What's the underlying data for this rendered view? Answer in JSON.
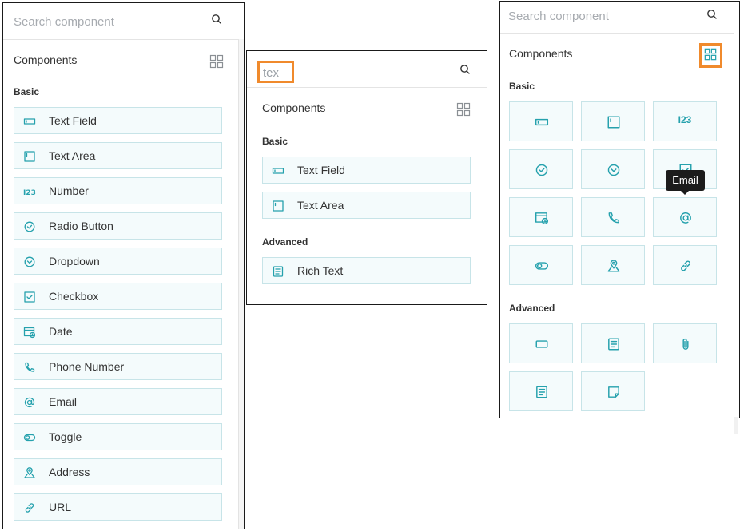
{
  "panel_list": {
    "search_placeholder": "Search component",
    "header": "Components",
    "group_basic": "Basic",
    "items": [
      {
        "label": "Text Field",
        "icon": "text-field-icon"
      },
      {
        "label": "Text Area",
        "icon": "text-area-icon"
      },
      {
        "label": "Number",
        "icon": "number-icon"
      },
      {
        "label": "Radio Button",
        "icon": "radio-button-icon"
      },
      {
        "label": "Dropdown",
        "icon": "dropdown-icon"
      },
      {
        "label": "Checkbox",
        "icon": "checkbox-icon"
      },
      {
        "label": "Date",
        "icon": "date-icon"
      },
      {
        "label": "Phone Number",
        "icon": "phone-icon"
      },
      {
        "label": "Email",
        "icon": "email-icon"
      },
      {
        "label": "Toggle",
        "icon": "toggle-icon"
      },
      {
        "label": "Address",
        "icon": "address-icon"
      },
      {
        "label": "URL",
        "icon": "url-icon"
      }
    ]
  },
  "panel_search": {
    "search_value": "tex",
    "header": "Components",
    "group_basic": "Basic",
    "group_advanced": "Advanced",
    "basic_items": [
      {
        "label": "Text Field",
        "icon": "text-field-icon"
      },
      {
        "label": "Text Area",
        "icon": "text-area-icon"
      }
    ],
    "advanced_items": [
      {
        "label": "Rich Text",
        "icon": "rich-text-icon"
      }
    ]
  },
  "panel_grid": {
    "search_placeholder": "Search component",
    "header": "Components",
    "group_basic": "Basic",
    "group_advanced": "Advanced",
    "number_tile_text": "I23",
    "tooltip": "Email"
  },
  "colors": {
    "accent": "#25a1ad",
    "highlight": "#f08a2c",
    "item_bg": "#f4fbfc",
    "item_border": "#c7e4e8",
    "tooltip_bg": "#1c1c1c"
  }
}
